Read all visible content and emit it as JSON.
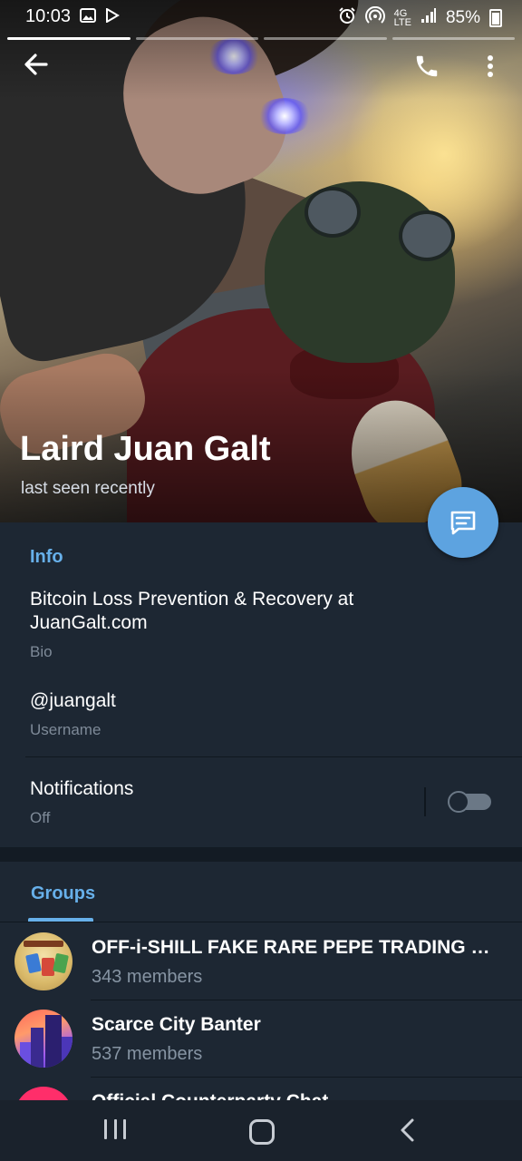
{
  "status": {
    "time": "10:03",
    "network": "4G",
    "network_sub": "LTE",
    "battery": "85%"
  },
  "story": {
    "segments": 4,
    "active": 1
  },
  "profile": {
    "name": "Laird Juan Galt",
    "last_seen": "last seen recently"
  },
  "info": {
    "header": "Info",
    "bio": "Bitcoin Loss Prevention & Recovery at JuanGalt.com",
    "bio_caption": "Bio",
    "username": "@juangalt",
    "username_caption": "Username",
    "notifications_label": "Notifications",
    "notifications_state": "Off",
    "notifications_enabled": false
  },
  "groups": {
    "tab_label": "Groups",
    "items": [
      {
        "title": "OFF-i-SHILL FAKE RARE PEPE TRADING C...",
        "members": "343 members"
      },
      {
        "title": "Scarce City Banter",
        "members": "537 members"
      },
      {
        "title": "Official Counterparty Chat",
        "members": ""
      }
    ]
  },
  "colors": {
    "accent": "#67b0ea",
    "fab": "#5da3e0",
    "background": "#1d2733"
  },
  "icons": {
    "back": "back-arrow-icon",
    "call": "phone-icon",
    "more": "more-vertical-icon",
    "fab": "message-icon"
  }
}
